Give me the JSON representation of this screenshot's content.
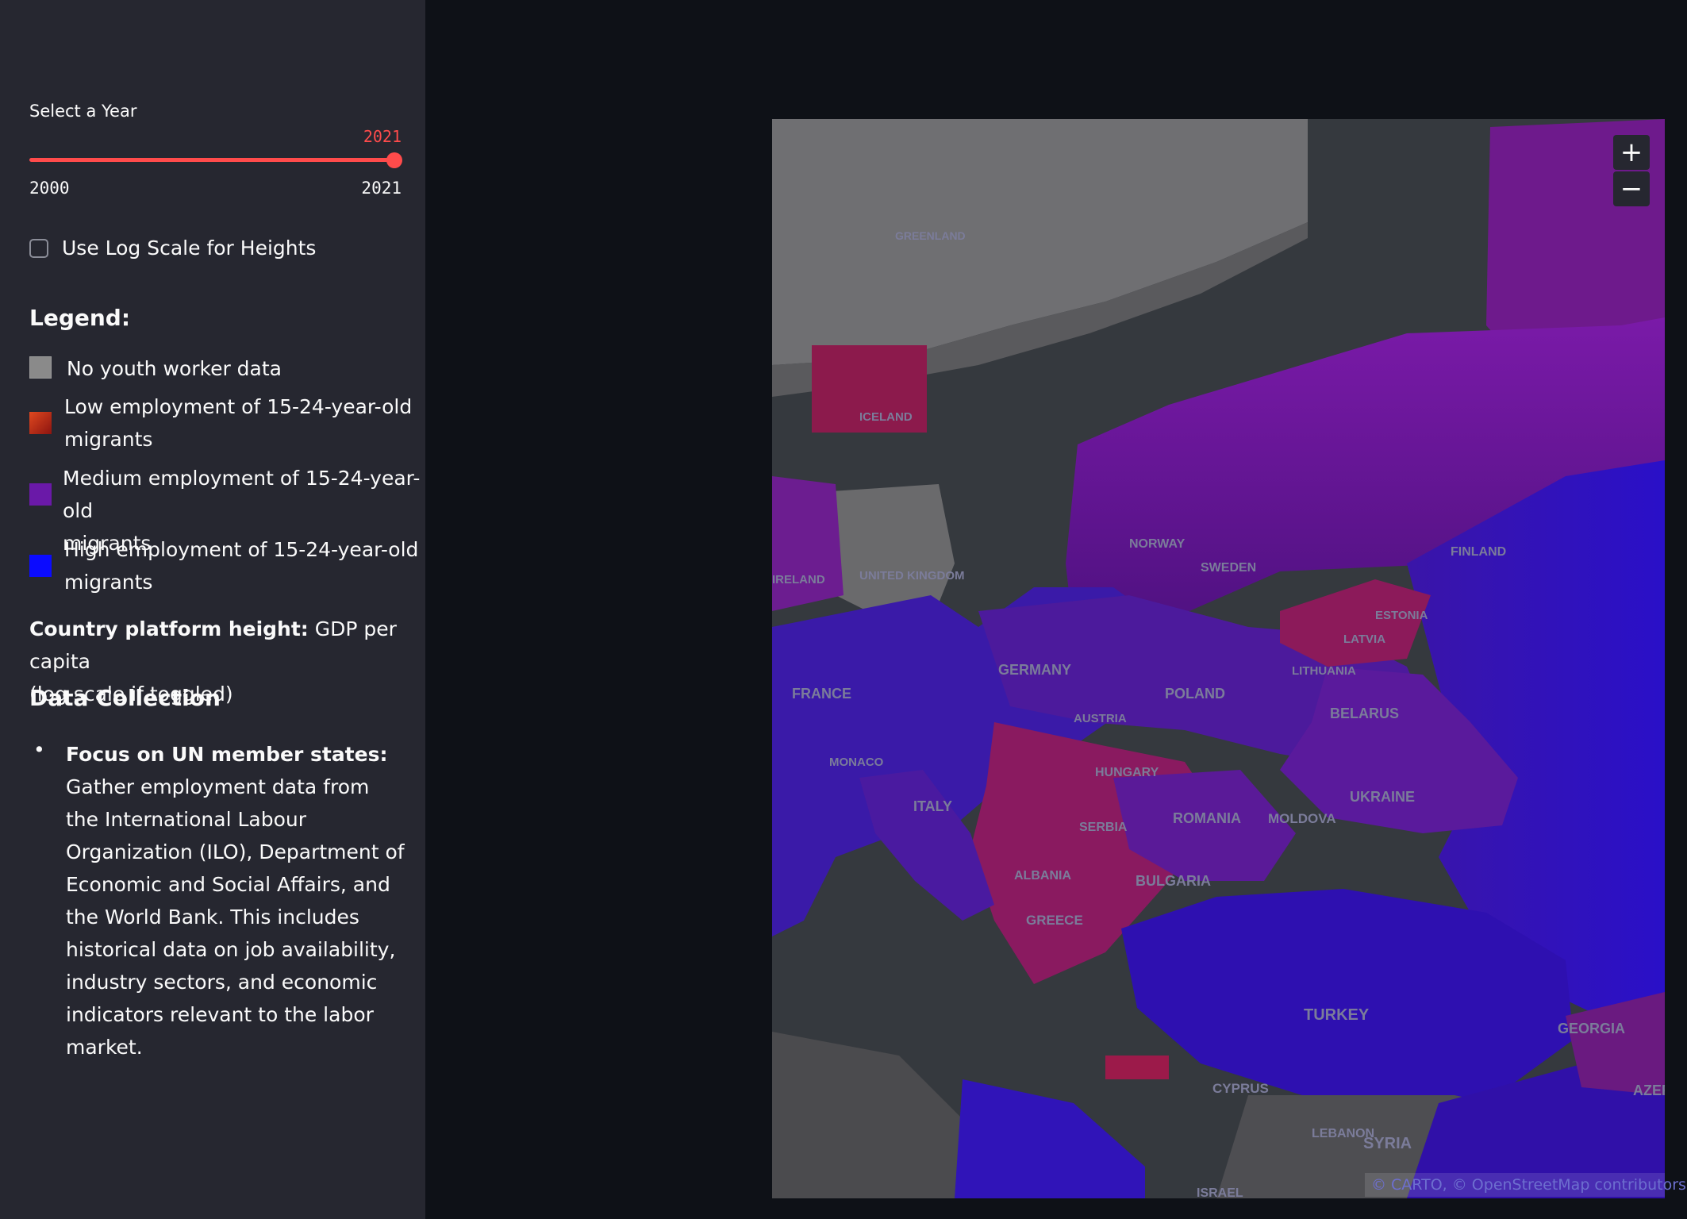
{
  "sidebar": {
    "slider": {
      "label": "Select a Year",
      "value": "2021",
      "min": "2000",
      "max": "2021"
    },
    "log_toggle": {
      "label": "Use Log Scale for Heights",
      "checked": false
    },
    "legend": {
      "title": "Legend:",
      "items": [
        {
          "color": "#8a8a8a",
          "line1": "No youth worker data",
          "line2": ""
        },
        {
          "color": "#c0311f",
          "line1": "Low employment of 15-24-year-old",
          "line2": "migrants"
        },
        {
          "color": "#6a19a8",
          "line1": "Medium employment of 15-24-year-old",
          "line2": "migrants"
        },
        {
          "color": "#0b0bff",
          "line1": "High employment of 15-24-year-old",
          "line2": "migrants"
        }
      ]
    },
    "platform": {
      "bold": "Country platform height:",
      "line1": " GDP per capita",
      "line2": "(log scale if toggled)"
    },
    "data_collection": {
      "title": "Data Collection",
      "bullet": "•",
      "bold": "Focus on UN member states:",
      "text": " Gather employment data from the International Labour Organization (ILO), Department of Economic and Social Affairs, and the World Bank. This includes historical data on job availability, industry sectors, and economic indicators relevant to the labor market."
    }
  },
  "map": {
    "zoom_in": "+",
    "zoom_out": "−",
    "attribution": "© CARTO, © OpenStreetMap contributors",
    "labels": [
      "GREENLAND",
      "ICELAND",
      "NORWAY",
      "SWEDEN",
      "FINLAND",
      "UNITED KINGDOM",
      "IRELAND",
      "FRANCE",
      "GERMANY",
      "POLAND",
      "BELARUS",
      "LITHUANIA",
      "LATVIA",
      "ESTONIA",
      "UKRAINE",
      "MOLDOVA",
      "ROMANIA",
      "HUNGARY",
      "AUSTRIA",
      "SERBIA",
      "BULGARIA",
      "ALBANIA",
      "GREECE",
      "ITALY",
      "MONACO",
      "TURKEY",
      "GEORGIA",
      "AZERBAIJAN",
      "CYPRUS",
      "SYRIA",
      "LEBANON",
      "ISRAEL"
    ]
  }
}
